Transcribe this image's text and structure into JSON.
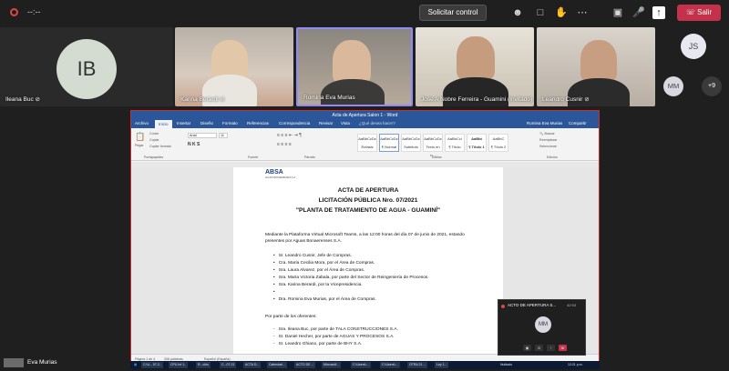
{
  "topbar": {
    "timer": "--:--",
    "request_control": "Solicitar control",
    "leave": "Salir",
    "icons": [
      "people-icon",
      "chat-icon",
      "raise-hand-icon",
      "more-icon",
      "camera-off-icon",
      "mic-off-icon",
      "share-icon"
    ]
  },
  "participants": {
    "ileana": {
      "initials": "IB",
      "name": "Ileana Buc"
    },
    "karina": {
      "name": "Karina Berardi"
    },
    "romina": {
      "name": "Romina Eva Murias"
    },
    "jose": {
      "name": "Jose A Nobre Ferreira - Guamini (Invitado)"
    },
    "leandro": {
      "name": "Leandro Cusnir"
    },
    "js": {
      "initials": "JS"
    },
    "mm": {
      "initials": "MM"
    },
    "more": "+9",
    "self": {
      "name": "Eva Murias"
    }
  },
  "word": {
    "title": "Acta de Apertura Salon 1 - Word",
    "tabs": [
      "Archivo",
      "Inicio",
      "Insertar",
      "Diseño",
      "Formato",
      "Referencias",
      "Correspondencia",
      "Revisar",
      "Vista",
      "¿Qué desea hacer?"
    ],
    "user": "Romina Eva Murias",
    "share": "Compartir",
    "clipboard": {
      "paste": "Pegar",
      "cut": "Cortar",
      "copy": "Copiar",
      "format": "Copiar formato",
      "group": "Portapapeles"
    },
    "font": {
      "name": "Arial",
      "size": "11",
      "group": "Fuente"
    },
    "paragraph_group": "Párrafo",
    "styles": [
      {
        "preview": "AaBbCcDc",
        "name": "Énfasis"
      },
      {
        "preview": "AaBbCcDc",
        "name": "¶ Normal"
      },
      {
        "preview": "AaBbCcDc",
        "name": "Subtítulo"
      },
      {
        "preview": "AaBbCcDc",
        "name": "Texto en n..."
      },
      {
        "preview": "AaBbCcI",
        "name": "¶ Título"
      },
      {
        "preview": "AaBbt",
        "name": "¶ Título 1"
      },
      {
        "preview": "AaBbC",
        "name": "¶ Título 2"
      }
    ],
    "styles_group": "Estilos",
    "editing": {
      "find": "Buscar",
      "replace": "Reemplazar",
      "select": "Seleccionar",
      "group": "Edición"
    },
    "document": {
      "logo": "ABSA",
      "logo_sub": "AGUAS BONAERENSES S.A.",
      "heading1": "ACTA DE APERTURA",
      "heading2": "LICITACIÓN PÚBLICA Nro. 07/2021",
      "heading3": "\"PLANTA DE TRATAMIENTO DE AGUA - GUAMINÍ\"",
      "intro_line1": "Mediante la Plataforma Virtual Microsoft Teams, a las 12:00 horas del día 07 de junio de 2021, estando",
      "intro_line2": "presentes por Aguas Bonaerenses S.A.",
      "attendees": [
        "Sr. Leandro Cusnir, Jefe de Compras.",
        "Cra. María Cecilia Mora, por el Área de Compras.",
        "Sra. Laura Alvarez, por el Área de Compras.",
        "Sra. María Victoria Zabala, por parte del Sector de Reingeniería de Procesos.",
        "Sra. Karina Berardi, por la Vicepresidencia.",
        "",
        "Dra. Romina Eva Murias, por el Área de Compras."
      ],
      "offerers_title": "Por parte de los oferentes:",
      "offerers": [
        "Sra. Ileana Buc, por parte de TALA CONSTRUCCIONES S.A.",
        "Sr. Daniel Hecher, por parte de AGUAS Y PROCESOS S.A.",
        "Sr. Leandro Ghiano, por parte de BHY S.A."
      ]
    },
    "status": {
      "page": "Página 1 de 4",
      "words": "306 palabras",
      "lang": "Español (España)"
    }
  },
  "taskbar": {
    "items": [
      "",
      "",
      "",
      "",
      "C:\\U... 07-2..",
      "CPU Inf 1..",
      "R...ción",
      "C...07-21",
      "ACTA D...",
      "Calendari...",
      "ACTO DE ...",
      "Microsoft...",
      "C:\\Users\\...",
      "C:\\Users\\...",
      "OTRA 21 ...",
      "Ley 1..."
    ],
    "weather": "Nublado",
    "clock": "12:21 p.m."
  },
  "popup": {
    "title": "ACTO DE APERTURA S...",
    "time": "42:53",
    "avatar": "MM"
  }
}
